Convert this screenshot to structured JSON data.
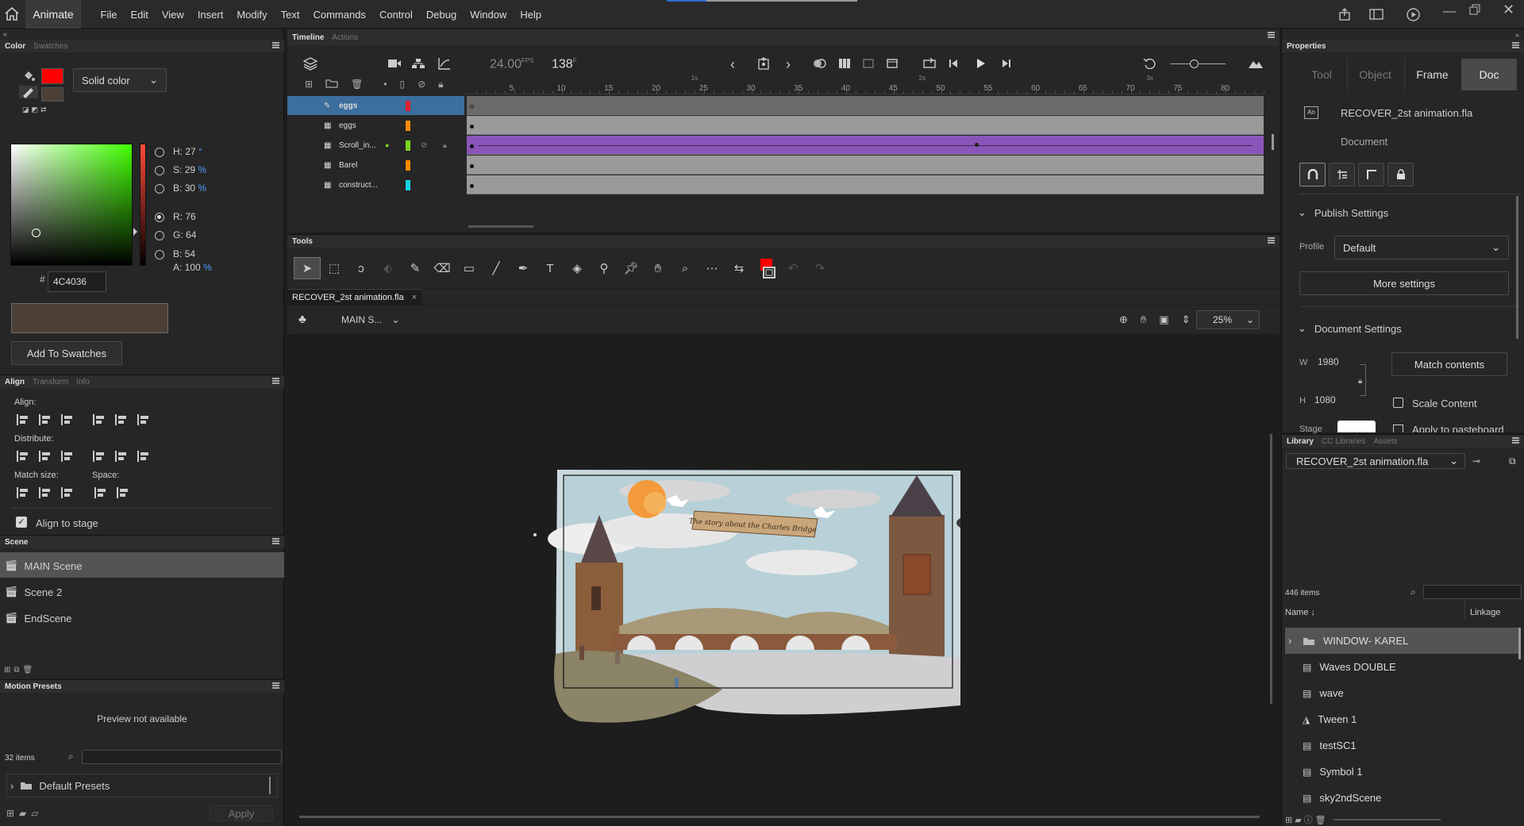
{
  "app": {
    "name": "Animate"
  },
  "menu": [
    "File",
    "Edit",
    "View",
    "Insert",
    "Modify",
    "Text",
    "Commands",
    "Control",
    "Debug",
    "Window",
    "Help"
  ],
  "color_panel": {
    "tab_active": "Color",
    "tab_inactive": "Swatches",
    "fill_type": "Solid color",
    "fill_color": "#ff0000",
    "current_color": "#4C4036",
    "H_label": "H:",
    "H_value": "27",
    "H_unit": "°",
    "S_label": "S:",
    "S_value": "29",
    "S_unit": "%",
    "B_label": "B:",
    "B_value": "30",
    "B_unit": "%",
    "R_label": "R:",
    "R_value": "76",
    "G_label": "G:",
    "G_value": "64",
    "B2_label": "B:",
    "B2_value": "54",
    "A_label": "A:",
    "A_value": "100",
    "A_unit": "%",
    "hash": "#",
    "hex": "4C4036",
    "add_swatches": "Add To Swatches"
  },
  "align_panel": {
    "tabs": [
      "Align",
      "Transform",
      "Info"
    ],
    "align_label": "Align:",
    "distribute_label": "Distribute:",
    "match_size_label": "Match size:",
    "space_label": "Space:",
    "align_to_stage": "Align to stage"
  },
  "scene_panel": {
    "title": "Scene",
    "scenes": [
      "MAIN Scene",
      "Scene 2",
      "EndScene"
    ]
  },
  "motion_presets": {
    "title": "Motion Presets",
    "preview": "Preview not available",
    "count": "32 items",
    "folder": "Default Presets",
    "apply": "Apply"
  },
  "timeline": {
    "tab_active": "Timeline",
    "tab_inactive": "Actions",
    "fps": "24.00",
    "fps_unit": "FPS",
    "frame": "138",
    "frame_unit": "F",
    "ruler": [
      "5",
      "10",
      "15",
      "20",
      "25",
      "30",
      "35",
      "40",
      "45",
      "50",
      "55",
      "60",
      "65",
      "70",
      "75",
      "80"
    ],
    "ruler_seconds": [
      "1s",
      "2s",
      "3s"
    ],
    "layers": [
      {
        "name": "eggs",
        "color": "#e0202a"
      },
      {
        "name": "eggs",
        "color": "#ff8a00"
      },
      {
        "name": "Scroll_in...",
        "color": "#7bd321"
      },
      {
        "name": "Barel",
        "color": "#ff8a00"
      },
      {
        "name": "construct...",
        "color": "#17d3e6"
      }
    ]
  },
  "tools": {
    "title": "Tools"
  },
  "document": {
    "tab": "RECOVER_2st animation.fla",
    "scene_name": "MAIN S...",
    "zoom": "25%",
    "banner_text": "The story about the Charles Bridge"
  },
  "properties": {
    "title": "Properties",
    "tabs": [
      "Tool",
      "Object",
      "Frame",
      "Doc"
    ],
    "filename": "RECOVER_2st animation.fla",
    "subtitle": "Document",
    "publish_settings": "Publish Settings",
    "profile_label": "Profile",
    "profile_value": "Default",
    "more_settings": "More settings",
    "document_settings": "Document Settings",
    "W_label": "W",
    "W_value": "1980",
    "H_label": "H",
    "H_value": "1080",
    "match_contents": "Match contents",
    "scale_content": "Scale Content",
    "stage_label": "Stage",
    "apply_pasteboard": "Apply to pasteboard"
  },
  "library": {
    "tabs": [
      "Library",
      "CC Libraries",
      "Assets"
    ],
    "file": "RECOVER_2st animation.fla",
    "count": "446 items",
    "col_name": "Name",
    "col_linkage": "Linkage",
    "items": [
      {
        "name": "WINDOW- KAREL",
        "type": "folder"
      },
      {
        "name": "Waves DOUBLE",
        "type": "symbol"
      },
      {
        "name": "wave",
        "type": "symbol"
      },
      {
        "name": "Tween 1",
        "type": "graphic"
      },
      {
        "name": "testSC1",
        "type": "symbol"
      },
      {
        "name": "Symbol 1",
        "type": "symbol"
      },
      {
        "name": "sky2ndScene",
        "type": "symbol"
      }
    ]
  }
}
